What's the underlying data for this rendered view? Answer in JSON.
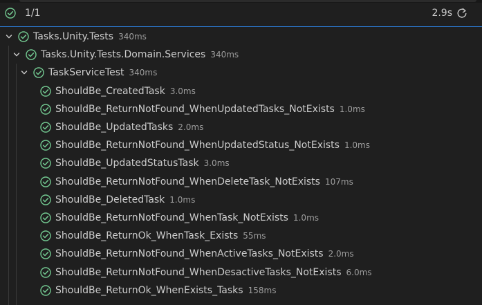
{
  "summary": {
    "count": "1/1",
    "duration": "2.9s",
    "refresh_icon": "refresh-icon",
    "status_icon": "pass-circle-icon"
  },
  "colors": {
    "pass": "#73c991",
    "focus_border": "#2b79d0",
    "background": "#1f1f1f"
  },
  "tree": {
    "nodes": [
      {
        "label": "Tasks.Unity.Tests",
        "duration": "340ms",
        "level": 0,
        "expandable": true
      },
      {
        "label": "Tasks.Unity.Tests.Domain.Services",
        "duration": "340ms",
        "level": 1,
        "expandable": true
      },
      {
        "label": "TaskServiceTest",
        "duration": "340ms",
        "level": 2,
        "expandable": true
      }
    ],
    "tests": [
      {
        "label": "ShouldBe_CreatedTask",
        "duration": "3.0ms"
      },
      {
        "label": "ShouldBe_ReturnNotFound_WhenUpdatedTasks_NotExists",
        "duration": "1.0ms"
      },
      {
        "label": "ShouldBe_UpdatedTasks",
        "duration": "2.0ms"
      },
      {
        "label": "ShouldBe_ReturnNotFound_WhenUpdatedStatus_NotExists",
        "duration": "1.0ms"
      },
      {
        "label": "ShouldBe_UpdatedStatusTask",
        "duration": "3.0ms"
      },
      {
        "label": "ShouldBe_ReturnNotFound_WhenDeleteTask_NotExists",
        "duration": "107ms"
      },
      {
        "label": "ShouldBe_DeletedTask",
        "duration": "1.0ms"
      },
      {
        "label": "ShouldBe_ReturnNotFound_WhenTask_NotExists",
        "duration": "1.0ms"
      },
      {
        "label": "ShouldBe_ReturnOk_WhenTask_Exists",
        "duration": "55ms"
      },
      {
        "label": "ShouldBe_ReturnNotFound_WhenActiveTasks_NotExists",
        "duration": "2.0ms"
      },
      {
        "label": "ShouldBe_ReturnNotFound_WhenDesactiveTasks_NotExists",
        "duration": "6.0ms"
      },
      {
        "label": "ShouldBe_ReturnOk_WhenExists_Tasks",
        "duration": "158ms"
      }
    ]
  }
}
